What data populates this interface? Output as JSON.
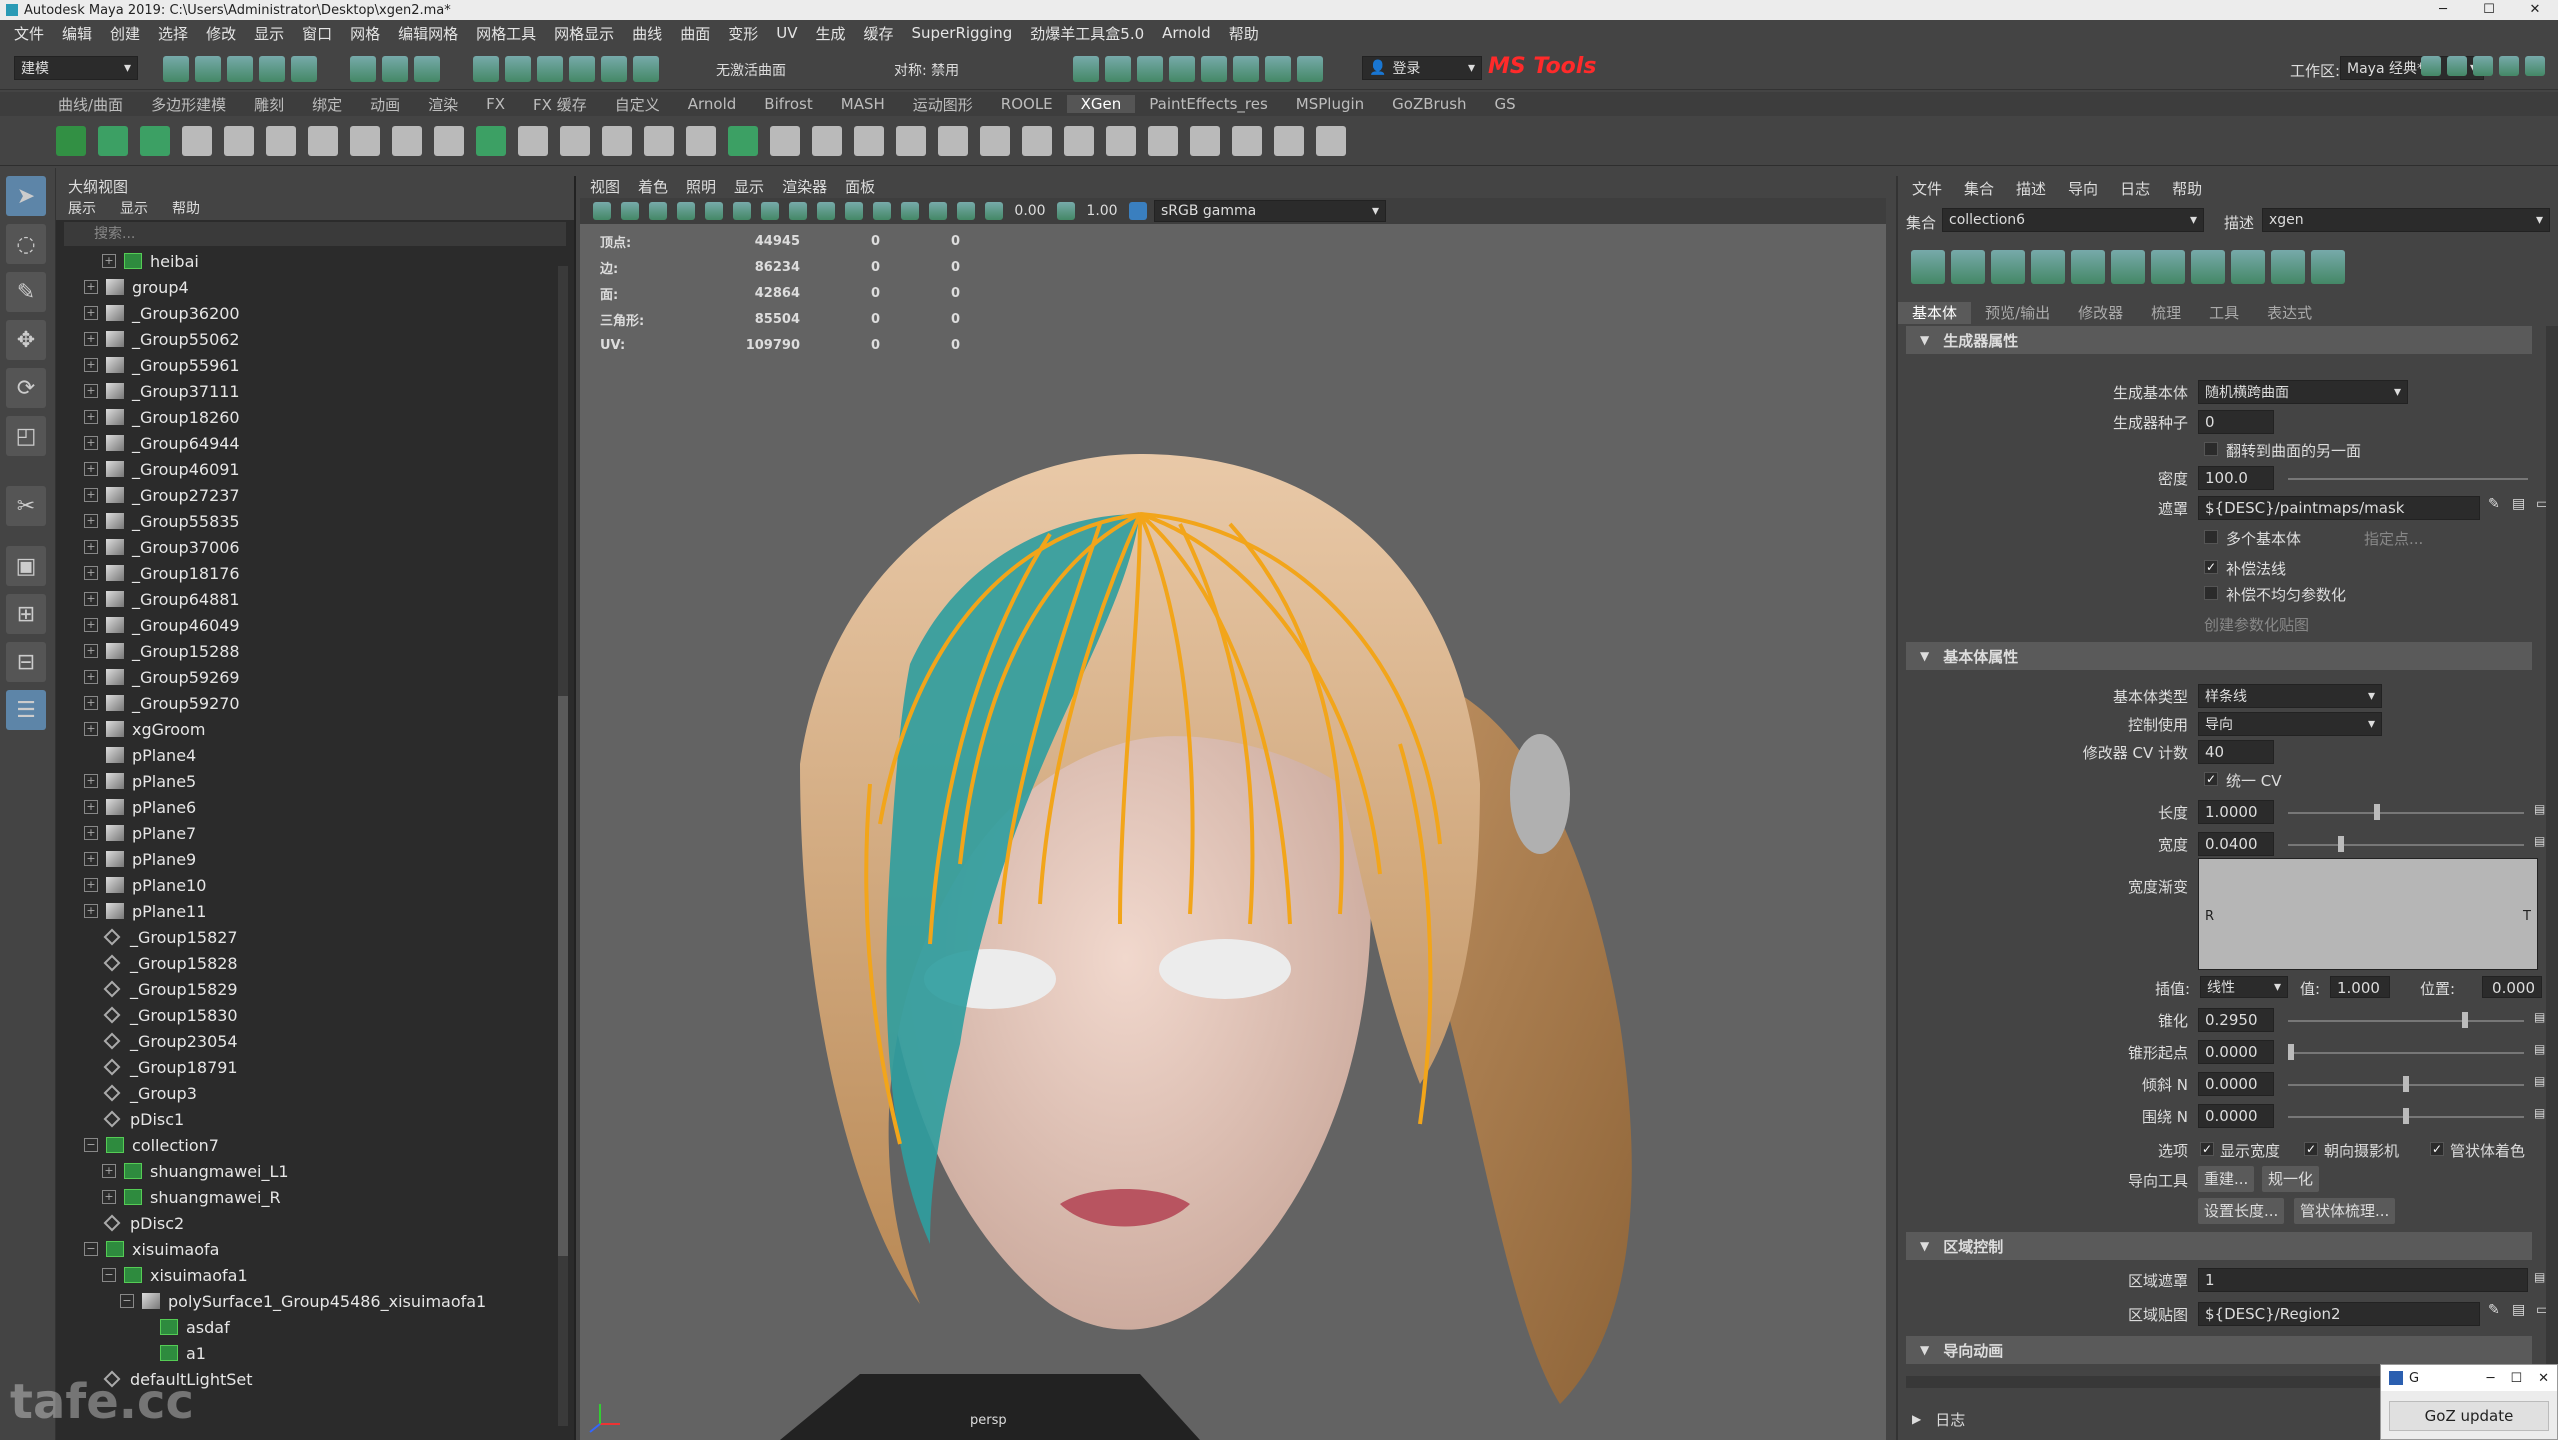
{
  "window": {
    "title": "Autodesk Maya 2019: C:\\Users\\Administrator\\Desktop\\xgen2.ma*"
  },
  "menu": [
    "文件",
    "编辑",
    "创建",
    "选择",
    "修改",
    "显示",
    "窗口",
    "网格",
    "编辑网格",
    "网格工具",
    "网格显示",
    "曲线",
    "曲面",
    "变形",
    "UV",
    "生成",
    "缓存",
    "SuperRigging",
    "劲爆羊工具盒5.0",
    "Arnold",
    "帮助"
  ],
  "status": {
    "mode": "建模",
    "live_surface": "无激活曲面",
    "symmetry": "对称: 禁用",
    "login": "登录",
    "ms_tools": "MS Tools",
    "workspace_label": "工作区:",
    "workspace": "Maya 经典*"
  },
  "shelf_tabs": [
    "曲线/曲面",
    "多边形建模",
    "雕刻",
    "绑定",
    "动画",
    "渲染",
    "FX",
    "FX 缓存",
    "自定义",
    "Arnold",
    "Bifrost",
    "MASH",
    "运动图形",
    "ROOLE",
    "XGen",
    "PaintEffects_res",
    "MSPlugin",
    "GoZBrush",
    "GS"
  ],
  "shelf_active": "XGen",
  "outliner": {
    "title": "大纲视图",
    "menu": [
      "展示",
      "显示",
      "帮助"
    ],
    "search_placeholder": "搜索...",
    "items": [
      {
        "label": "heibai",
        "type": "xg",
        "indent": 1
      },
      {
        "label": "group4",
        "type": "mesh",
        "indent": 0
      },
      {
        "label": "_Group36200",
        "type": "mesh",
        "indent": 0
      },
      {
        "label": "_Group55062",
        "type": "mesh",
        "indent": 0
      },
      {
        "label": "_Group55961",
        "type": "mesh",
        "indent": 0
      },
      {
        "label": "_Group37111",
        "type": "mesh",
        "indent": 0
      },
      {
        "label": "_Group18260",
        "type": "mesh",
        "indent": 0
      },
      {
        "label": "_Group64944",
        "type": "mesh",
        "indent": 0
      },
      {
        "label": "_Group46091",
        "type": "mesh",
        "indent": 0
      },
      {
        "label": "_Group27237",
        "type": "mesh",
        "indent": 0
      },
      {
        "label": "_Group55835",
        "type": "mesh",
        "indent": 0
      },
      {
        "label": "_Group37006",
        "type": "mesh",
        "indent": 0
      },
      {
        "label": "_Group18176",
        "type": "mesh",
        "indent": 0
      },
      {
        "label": "_Group64881",
        "type": "mesh",
        "indent": 0
      },
      {
        "label": "_Group46049",
        "type": "mesh",
        "indent": 0
      },
      {
        "label": "_Group15288",
        "type": "mesh",
        "indent": 0
      },
      {
        "label": "_Group59269",
        "type": "mesh",
        "indent": 0
      },
      {
        "label": "_Group59270",
        "type": "mesh",
        "indent": 0
      },
      {
        "label": "xgGroom",
        "type": "mesh",
        "indent": 0
      },
      {
        "label": "pPlane4",
        "type": "mesh",
        "indent": 0,
        "noexp": true
      },
      {
        "label": "pPlane5",
        "type": "mesh",
        "indent": 0
      },
      {
        "label": "pPlane6",
        "type": "mesh",
        "indent": 0
      },
      {
        "label": "pPlane7",
        "type": "mesh",
        "indent": 0
      },
      {
        "label": "pPlane9",
        "type": "mesh",
        "indent": 0
      },
      {
        "label": "pPlane10",
        "type": "mesh",
        "indent": 0
      },
      {
        "label": "pPlane11",
        "type": "mesh",
        "indent": 0
      },
      {
        "label": "_Group15827",
        "type": "grp",
        "indent": 0,
        "noexp": true
      },
      {
        "label": "_Group15828",
        "type": "grp",
        "indent": 0,
        "noexp": true
      },
      {
        "label": "_Group15829",
        "type": "grp",
        "indent": 0,
        "noexp": true
      },
      {
        "label": "_Group15830",
        "type": "grp",
        "indent": 0,
        "noexp": true
      },
      {
        "label": "_Group23054",
        "type": "grp",
        "indent": 0,
        "noexp": true
      },
      {
        "label": "_Group18791",
        "type": "grp",
        "indent": 0,
        "noexp": true
      },
      {
        "label": "_Group3",
        "type": "grp",
        "indent": 0,
        "noexp": true
      },
      {
        "label": "pDisc1",
        "type": "grp",
        "indent": 0,
        "noexp": true
      },
      {
        "label": "collection7",
        "type": "xg",
        "indent": 0,
        "open": true
      },
      {
        "label": "shuangmawei_L1",
        "type": "xg",
        "indent": 1
      },
      {
        "label": "shuangmawei_R",
        "type": "xg",
        "indent": 1
      },
      {
        "label": "pDisc2",
        "type": "grp",
        "indent": 0,
        "noexp": true
      },
      {
        "label": "xisuimaofa",
        "type": "xg",
        "indent": 0,
        "open": true
      },
      {
        "label": "xisuimaofa1",
        "type": "xg",
        "indent": 1,
        "open": true
      },
      {
        "label": "polySurface1_Group45486_xisuimaofa1",
        "type": "mesh",
        "indent": 2,
        "open": true
      },
      {
        "label": "asdaf",
        "type": "xg",
        "indent": 3,
        "noexp": true
      },
      {
        "label": "a1",
        "type": "xg",
        "indent": 3,
        "noexp": true
      },
      {
        "label": "defaultLightSet",
        "type": "grp",
        "indent": 0,
        "noexp": true
      }
    ]
  },
  "viewport": {
    "menu": [
      "视图",
      "着色",
      "照明",
      "显示",
      "渲染器",
      "面板"
    ],
    "exposure": "0.00",
    "gamma": "1.00",
    "colorspace": "sRGB gamma",
    "camera_label": "persp",
    "hud": [
      {
        "label": "顶点:",
        "a": "44945",
        "b": "0",
        "c": "0"
      },
      {
        "label": "边:",
        "a": "86234",
        "b": "0",
        "c": "0"
      },
      {
        "label": "面:",
        "a": "42864",
        "b": "0",
        "c": "0"
      },
      {
        "label": "三角形:",
        "a": "85504",
        "b": "0",
        "c": "0"
      },
      {
        "label": "UV:",
        "a": "109790",
        "b": "0",
        "c": "0"
      }
    ]
  },
  "xgen": {
    "menu": [
      "文件",
      "集合",
      "描述",
      "导向",
      "日志",
      "帮助"
    ],
    "collection_label": "集合",
    "collection": "collection6",
    "description_label": "描述",
    "description": "xgen",
    "tabs": [
      "基本体",
      "预览/输出",
      "修改器",
      "梳理",
      "工具",
      "表达式"
    ],
    "sec_generator": "生成器属性",
    "gen_primitive_label": "生成基本体",
    "gen_primitive": "随机横跨曲面",
    "gen_seed_label": "生成器种子",
    "gen_seed": "0",
    "flip_label": "翻转到曲面的另一面",
    "density_label": "密度",
    "density": "100.0",
    "mask_label": "遮罩",
    "mask": "${DESC}/paintmaps/mask",
    "multi_label": "多个基本体",
    "specify_label": "指定点...",
    "comp_normal_label": "补偿法线",
    "comp_uneven_label": "补偿不均匀参数化",
    "create_map_label": "创建参数化贴图",
    "sec_primitive": "基本体属性",
    "prim_type_label": "基本体类型",
    "prim_type": "样条线",
    "control_label": "控制使用",
    "control": "导向",
    "cv_label": "修改器 CV 计数",
    "cv": "40",
    "unify_cv_label": "统一 CV",
    "length_label": "长度",
    "length": "1.0000",
    "width_label": "宽度",
    "width": "0.0400",
    "ramp_label": "宽度渐变",
    "ramp_r": "R",
    "ramp_t": "T",
    "interp_label": "插值:",
    "interp": "线性",
    "value_label": "值:",
    "value": "1.000",
    "position_label": "位置:",
    "position": "0.000",
    "taper_label": "锥化",
    "taper": "0.2950",
    "taper_start_label": "锥形起点",
    "taper_start": "0.0000",
    "tilt_label": "倾斜 N",
    "tilt": "0.0000",
    "wrap_label": "围绕 N",
    "wrap": "0.0000",
    "options_label": "选项",
    "show_width_label": "显示宽度",
    "face_cam_label": "朝向摄影机",
    "tube_label": "管状体着色",
    "guide_tools_label": "导向工具",
    "rebuild_btn": "重建...",
    "normalize_btn": "规一化",
    "set_length_btn": "设置长度...",
    "tube_comb_btn": "管状体梳理...",
    "sec_region": "区域控制",
    "region_mask_label": "区域遮罩",
    "region_mask": "1",
    "region_map_label": "区域贴图",
    "region_map": "${DESC}/Region2",
    "sec_guide_anim": "导向动画",
    "log_label": "日志"
  },
  "goz": {
    "title": "G",
    "button": "GoZ update"
  },
  "watermark": "tafe.cc",
  "colors": {
    "accent": "#5d85a8",
    "xgen_green": "#2e8b3e"
  }
}
